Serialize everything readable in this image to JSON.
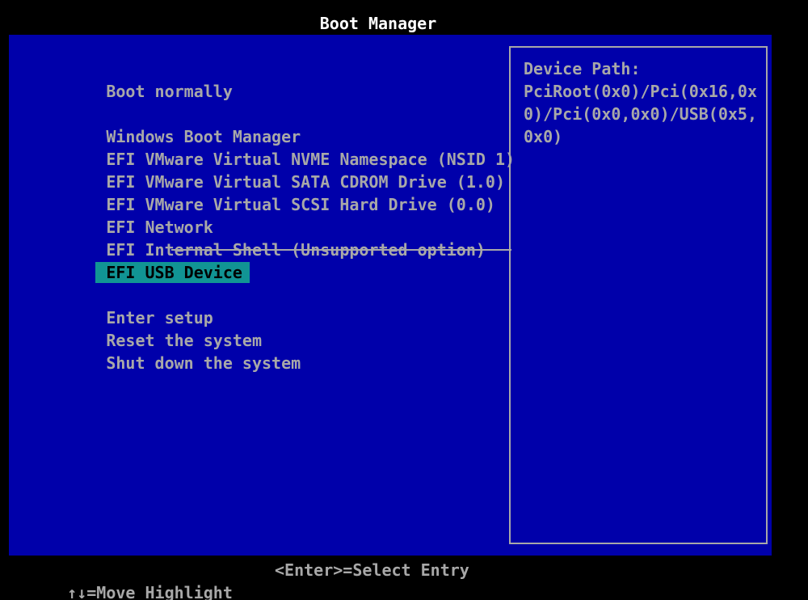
{
  "title": "Boot Manager",
  "menu": {
    "items": [
      {
        "label": "Boot normally",
        "highlighted": false
      },
      {
        "label": "Windows Boot Manager",
        "highlighted": false
      },
      {
        "label": "EFI VMware Virtual NVME Namespace (NSID 1)",
        "highlighted": false
      },
      {
        "label": "EFI VMware Virtual SATA CDROM Drive (1.0)",
        "highlighted": false
      },
      {
        "label": "EFI VMware Virtual SCSI Hard Drive (0.0)",
        "highlighted": false
      },
      {
        "label": "EFI Network",
        "highlighted": false
      },
      {
        "label": "EFI Internal Shell (Unsupported option)",
        "highlighted": false
      },
      {
        "label": "EFI USB Device",
        "highlighted": true
      },
      {
        "label": "Enter setup",
        "highlighted": false
      },
      {
        "label": "Reset the system",
        "highlighted": false
      },
      {
        "label": "Shut down the system",
        "highlighted": false
      }
    ]
  },
  "device_path_panel": {
    "heading": "Device Path:",
    "path_lines": [
      "PciRoot(0x0)/Pci(0x16,0x",
      "0)/Pci(0x0,0x0)/USB(0x5,",
      "0x0)"
    ]
  },
  "help_bar": {
    "move_hint": "↑↓=Move Highlight",
    "select_hint": "<Enter>=Select Entry"
  },
  "colors": {
    "background": "#000000",
    "panel_blue": "#0000AA",
    "text_gray": "#A8A8A8",
    "title_white": "#FFFFFF",
    "highlight_teal": "#119494",
    "highlight_text": "#000000"
  }
}
